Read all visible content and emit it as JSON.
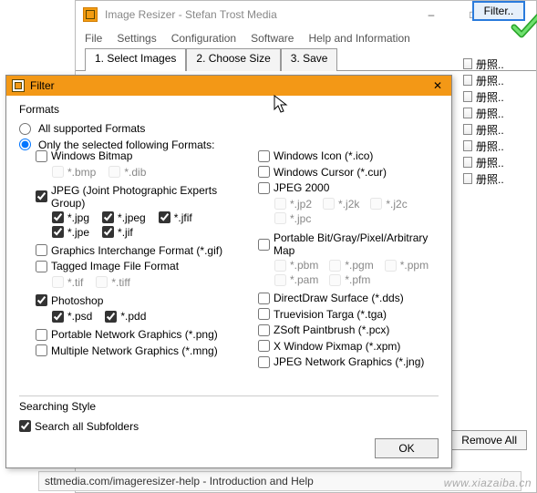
{
  "main": {
    "title": "Image Resizer - Stefan Trost Media",
    "menus": [
      "File",
      "Settings",
      "Configuration",
      "Software",
      "Help and Information"
    ],
    "tabs": [
      "1. Select Images",
      "2. Choose Size",
      "3. Save"
    ],
    "filter_btn": "Filter..",
    "list_items": [
      "册照..",
      "册照..",
      "册照..",
      "册照..",
      "册照..",
      "册照..",
      "册照..",
      "册照.."
    ],
    "remove_all": "Remove All",
    "help_strip": "sttmedia.com/imageresizer-help - Introduction and Help",
    "help_badge": "?",
    "watermark": "www.xiazaiba.cn"
  },
  "dialog": {
    "title": "Filter",
    "formats_label": "Formats",
    "radio_all": "All supported Formats",
    "radio_sel": "Only the selected following Formats:",
    "left": {
      "winbmp": "Windows Bitmap",
      "bmp": "*.bmp",
      "dib": "*.dib",
      "jpeg_group": "JPEG (Joint Photographic Experts Group)",
      "jpg": "*.jpg",
      "jpeg": "*.jpeg",
      "jfif": "*.jfif",
      "jpe": "*.jpe",
      "jif": "*.jif",
      "gif": "Graphics Interchange Format (*.gif)",
      "tiff_group": "Tagged Image File Format",
      "tif": "*.tif",
      "tiff": "*.tiff",
      "ps": "Photoshop",
      "psd": "*.psd",
      "pdd": "*.pdd",
      "png": "Portable Network Graphics (*.png)",
      "mng": "Multiple Network Graphics (*.mng)"
    },
    "right": {
      "ico": "Windows Icon (*.ico)",
      "cur": "Windows Cursor (*.cur)",
      "jp2k": "JPEG 2000",
      "jp2": "*.jp2",
      "j2k": "*.j2k",
      "j2c": "*.j2c",
      "jpc": "*.jpc",
      "pbm_group": "Portable Bit/Gray/Pixel/Arbitrary Map",
      "pbm": "*.pbm",
      "pgm": "*.pgm",
      "ppm": "*.ppm",
      "pam": "*.pam",
      "pfm": "*.pfm",
      "dds": "DirectDraw Surface (*.dds)",
      "tga": "Truevision Targa (*.tga)",
      "pcx": "ZSoft Paintbrush (*.pcx)",
      "xpm": "X Window Pixmap (*.xpm)",
      "jng": "JPEG Network Graphics (*.jng)"
    },
    "search_label": "Searching Style",
    "search_sub": "Search all Subfolders",
    "ok": "OK"
  }
}
